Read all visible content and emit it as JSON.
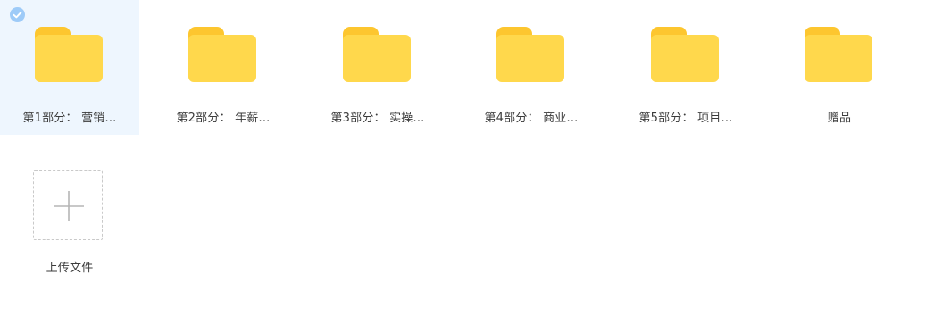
{
  "folders": [
    {
      "label": "第1部分：  营销...",
      "selected": true
    },
    {
      "label": "第2部分：  年薪...",
      "selected": false
    },
    {
      "label": "第3部分：  实操...",
      "selected": false
    },
    {
      "label": "第4部分：  商业...",
      "selected": false
    },
    {
      "label": "第5部分：  项目...",
      "selected": false
    },
    {
      "label": "赠品",
      "selected": false
    }
  ],
  "upload": {
    "label": "上传文件",
    "icon": "plus-icon"
  },
  "colors": {
    "folder_tab": "#fdc62f",
    "folder_body": "#ffd84c",
    "selected_bg": "#eef6fe",
    "check": "#9ecbf8"
  }
}
